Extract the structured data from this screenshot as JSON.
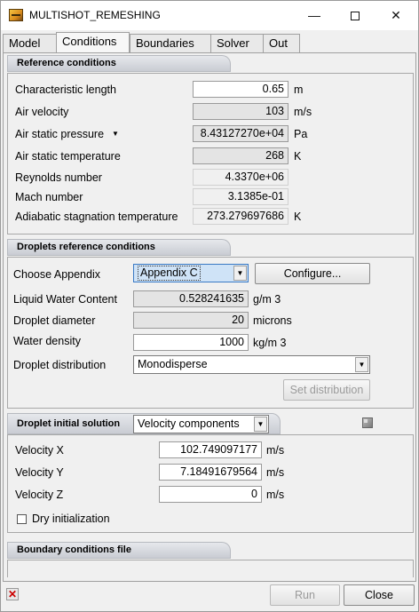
{
  "window": {
    "title": "MULTISHOT_REMESHING",
    "min": "—",
    "close": "✕"
  },
  "tabs": [
    "Model",
    "Conditions",
    "Boundaries",
    "Solver",
    "Out"
  ],
  "reference": {
    "header": "Reference conditions",
    "characteristic_length": {
      "label": "Characteristic length",
      "value": "0.65",
      "unit": "m"
    },
    "air_velocity": {
      "label": "Air velocity",
      "value": "103",
      "unit": "m/s"
    },
    "air_static_pressure": {
      "label": "Air static pressure",
      "value": "8.43127270e+04",
      "unit": "Pa"
    },
    "air_static_temperature": {
      "label": "Air static temperature",
      "value": "268",
      "unit": "K"
    },
    "reynolds": {
      "label": "Reynolds number",
      "value": "4.3370e+06"
    },
    "mach": {
      "label": "Mach number",
      "value": "3.1385e-01"
    },
    "adiabatic": {
      "label": "Adiabatic stagnation temperature",
      "value": "273.279697686",
      "unit": "K"
    }
  },
  "droplets": {
    "header": "Droplets reference conditions",
    "appendix": {
      "label": "Choose Appendix",
      "value": "Appendix C",
      "configure": "Configure..."
    },
    "lwc": {
      "label": "Liquid Water Content",
      "value": "0.528241635",
      "unit": "g/m 3"
    },
    "diameter": {
      "label": "Droplet diameter",
      "value": "20",
      "unit": "microns"
    },
    "density": {
      "label": "Water density",
      "value": "1000",
      "unit": "kg/m 3"
    },
    "distribution": {
      "label": "Droplet distribution",
      "value": "Monodisperse"
    },
    "set_distribution": "Set distribution"
  },
  "initial": {
    "header": "Droplet initial solution",
    "mode": "Velocity components",
    "vx": {
      "label": "Velocity X",
      "value": "102.749097177",
      "unit": "m/s"
    },
    "vy": {
      "label": "Velocity Y",
      "value": "7.18491679564",
      "unit": "m/s"
    },
    "vz": {
      "label": "Velocity Z",
      "value": "0",
      "unit": "m/s"
    },
    "dry_init": "Dry initialization"
  },
  "boundary": {
    "header": "Boundary conditions file"
  },
  "footer": {
    "run": "Run",
    "close": "Close"
  },
  "icons": {
    "app": "app-icon",
    "status": "error-icon",
    "cube": "cube-icon"
  }
}
